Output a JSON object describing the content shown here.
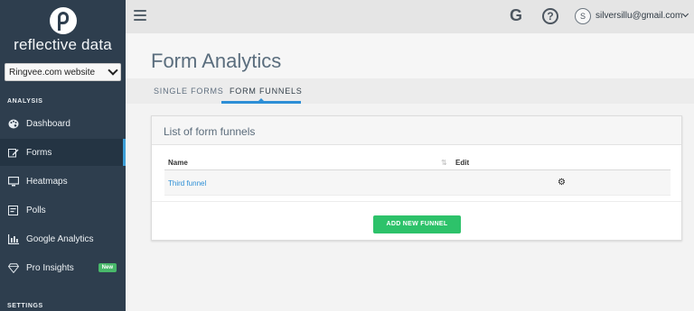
{
  "brand": {
    "name": "reflective data"
  },
  "site_select": {
    "value": "Ringvee.com website"
  },
  "sidebar": {
    "analysis_title": "ANALYSIS",
    "items": [
      {
        "label": "Dashboard",
        "icon": "palette-icon"
      },
      {
        "label": "Forms",
        "icon": "edit-icon"
      },
      {
        "label": "Heatmaps",
        "icon": "monitor-icon"
      },
      {
        "label": "Polls",
        "icon": "poll-icon"
      },
      {
        "label": "Google Analytics",
        "icon": "bar-chart-icon"
      },
      {
        "label": "Pro Insights",
        "icon": "diamond-icon",
        "badge": "New"
      }
    ],
    "settings_title": "SETTINGS"
  },
  "topbar": {
    "google_glyph": "G",
    "help_glyph": "?",
    "avatar_initial": "S",
    "email": "silversillu@gmail.com"
  },
  "page": {
    "title": "Form Analytics",
    "tabs": [
      {
        "label": "SINGLE FORMS"
      },
      {
        "label": "FORM FUNNELS",
        "active": true
      }
    ]
  },
  "card": {
    "title": "List of form funnels",
    "columns": [
      "Name",
      "Edit"
    ],
    "rows": [
      {
        "name": "Third funnel"
      }
    ],
    "add_button": "ADD NEW FUNNEL"
  },
  "colors": {
    "sidebar_bg": "#2e3e4e",
    "accent_blue": "#2d8fd6",
    "button_green": "#2dc26a",
    "badge_green": "#48b86a"
  }
}
